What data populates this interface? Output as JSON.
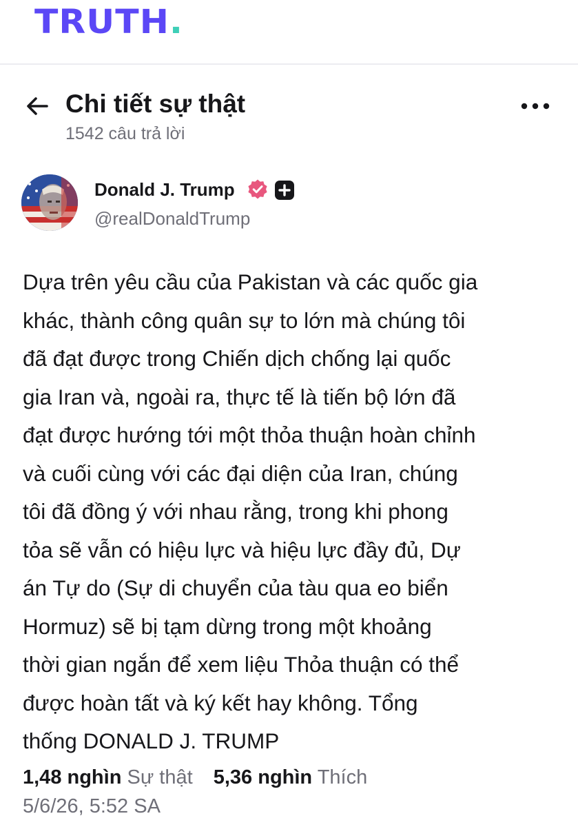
{
  "brand": {
    "logo_text": "TRUTH",
    "logo_dot": ".",
    "primary_color": "#5b47f6",
    "accent_color": "#3ecfb7"
  },
  "header": {
    "back_icon": "arrow-left-icon",
    "title": "Chi tiết sự thật",
    "reply_count": "1542 câu trả lời",
    "more_icon": "more-horizontal-icon"
  },
  "author": {
    "name": "Donald J. Trump",
    "handle": "@realDonaldTrump",
    "verified_icon": "verified-badge-icon",
    "verified_color": "#e8577e",
    "plus_icon": "plus-badge-icon"
  },
  "post": {
    "body": "Dựa trên yêu cầu của Pakistan và các quốc gia\nkhác, thành công quân sự to lớn mà chúng tôi\nđã đạt được trong Chiến dịch chống lại quốc\ngia Iran và, ngoài ra, thực tế là tiến bộ lớn đã\nđạt được hướng tới một thỏa thuận hoàn chỉnh\nvà cuối cùng với các đại diện của Iran, chúng\ntôi đã đồng ý với nhau rằng, trong khi phong\ntỏa sẽ vẫn có hiệu lực và hiệu lực đầy đủ, Dự\nán Tự do (Sự di chuyển của tàu qua eo biển\nHormuz) sẽ bị tạm dừng trong một khoảng\nthời gian ngắn để xem liệu Thỏa thuận có thể\nđược hoàn tất và ký kết hay không. Tổng\nthống DONALD J. TRUMP"
  },
  "stats": {
    "retruths_count": "1,48 nghìn",
    "retruths_label": "Sự thật",
    "likes_count": "5,36 nghìn",
    "likes_label": "Thích",
    "timestamp": "5/6/26, 5:52 SA"
  }
}
